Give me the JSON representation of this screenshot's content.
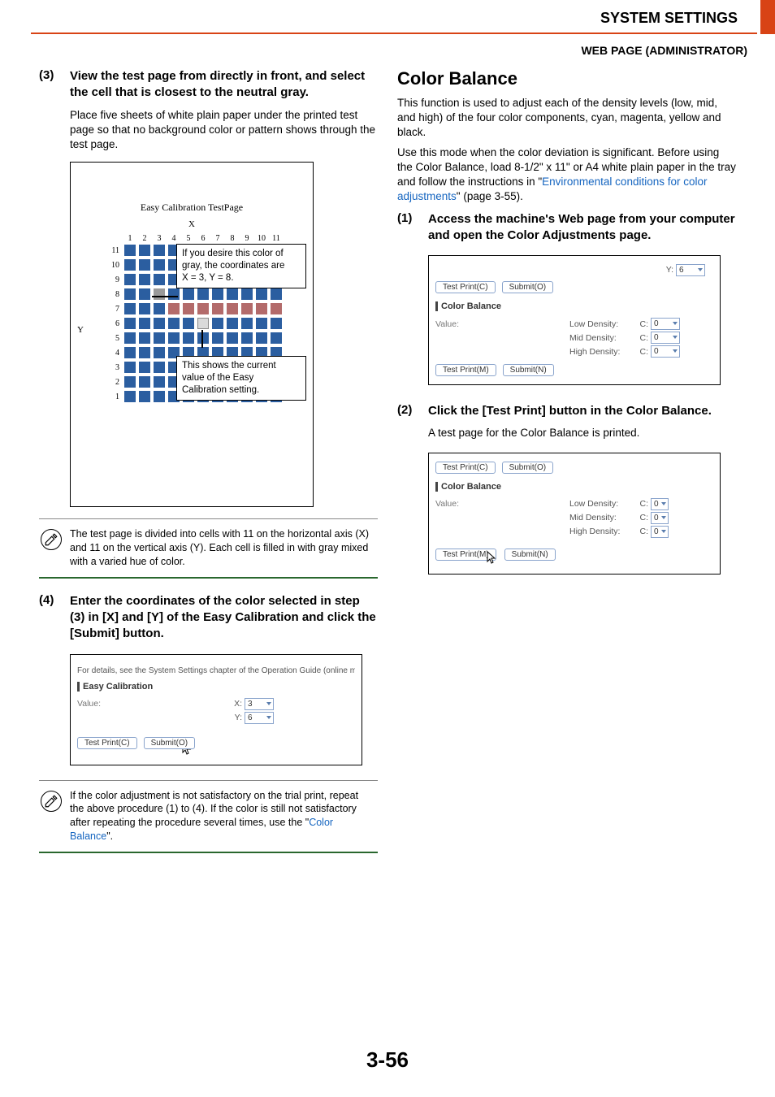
{
  "header": {
    "title": "SYSTEM SETTINGS",
    "subheader": "WEB PAGE (ADMINISTRATOR)"
  },
  "left": {
    "step3": {
      "num": "(3)",
      "title": "View the test page from directly in front, and select the cell that is closest to the neutral gray.",
      "body": "Place five sheets of white plain paper under the printed test page so that no background color or pattern shows through the test page."
    },
    "testpage": {
      "title": "Easy Calibration TestPage",
      "xlabel": "X",
      "ylabel": "Y",
      "cols": [
        "1",
        "2",
        "3",
        "4",
        "5",
        "6",
        "7",
        "8",
        "9",
        "10",
        "11"
      ],
      "rows": [
        "11",
        "10",
        "9",
        "8",
        "7",
        "6",
        "5",
        "4",
        "3",
        "2",
        "1"
      ],
      "callout1_l1": "If you desire this color of",
      "callout1_l2": "gray, the coordinates are",
      "callout1_l3": "X = 3, Y = 8.",
      "callout2_l1": "This shows the current",
      "callout2_l2": "value of the Easy",
      "callout2_l3": "Calibration setting."
    },
    "note1": "The test page is divided into cells with 11 on the horizontal axis (X) and 11 on the vertical axis (Y). Each cell is filled in with gray mixed with a varied hue of color.",
    "step4": {
      "num": "(4)",
      "title": "Enter the coordinates of the color selected in step (3) in [X] and [Y] of the Easy Calibration and click the [Submit] button."
    },
    "easycal_box": {
      "top_text": "For details, see the System Settings chapter of the Operation Guide (online manu",
      "heading": "Easy Calibration",
      "value_label": "Value:",
      "x_label": "X:",
      "x_value": "3",
      "y_label": "Y:",
      "y_value": "6",
      "btn_test": "Test Print(C)",
      "btn_submit": "Submit(O)"
    },
    "note2_pre": "If the color adjustment is not satisfactory on the trial print, repeat the above procedure (1) to (4). If the color is still not satisfactory after repeating the procedure several times, use the \"",
    "note2_link": "Color Balance",
    "note2_post": "\"."
  },
  "right": {
    "h2": "Color Balance",
    "p1": "This function is used to adjust each of the density levels (low, mid, and high) of the four color components, cyan, magenta, yellow and black.",
    "p2a": "Use this mode when the color deviation is significant. Before using the Color Balance, load 8-1/2\" x 11\" or A4 white plain paper in the tray and follow the instructions in \"",
    "p2_link": "Environmental conditions for color adjustments",
    "p2b": "\" (page 3-55).",
    "step1": {
      "num": "(1)",
      "title": "Access the machine's Web page from your computer and open the Color Adjustments page."
    },
    "cb_box1": {
      "top_y_label": "Y:",
      "top_y_value": "6",
      "btn_test_top": "Test Print(C)",
      "btn_submit_top": "Submit(O)",
      "heading": "Color Balance",
      "value_label": "Value:",
      "low": "Low Density:",
      "mid": "Mid Density:",
      "high": "High Density:",
      "c_label": "C:",
      "c_value": "0",
      "btn_test_bottom": "Test Print(M)",
      "btn_submit_bottom": "Submit(N)"
    },
    "step2": {
      "num": "(2)",
      "title": "Click the [Test Print] button in the Color Balance.",
      "body": "A test page for the Color Balance is printed."
    },
    "cb_box2": {
      "btn_test_top": "Test Print(C)",
      "btn_submit_top": "Submit(O)",
      "heading": "Color Balance",
      "value_label": "Value:",
      "low": "Low Density:",
      "mid": "Mid Density:",
      "high": "High Density:",
      "c_label": "C:",
      "c_value": "0",
      "btn_test_bottom": "Test Print(M)",
      "btn_submit_bottom": "Submit(N)"
    }
  },
  "page_number": "3-56"
}
